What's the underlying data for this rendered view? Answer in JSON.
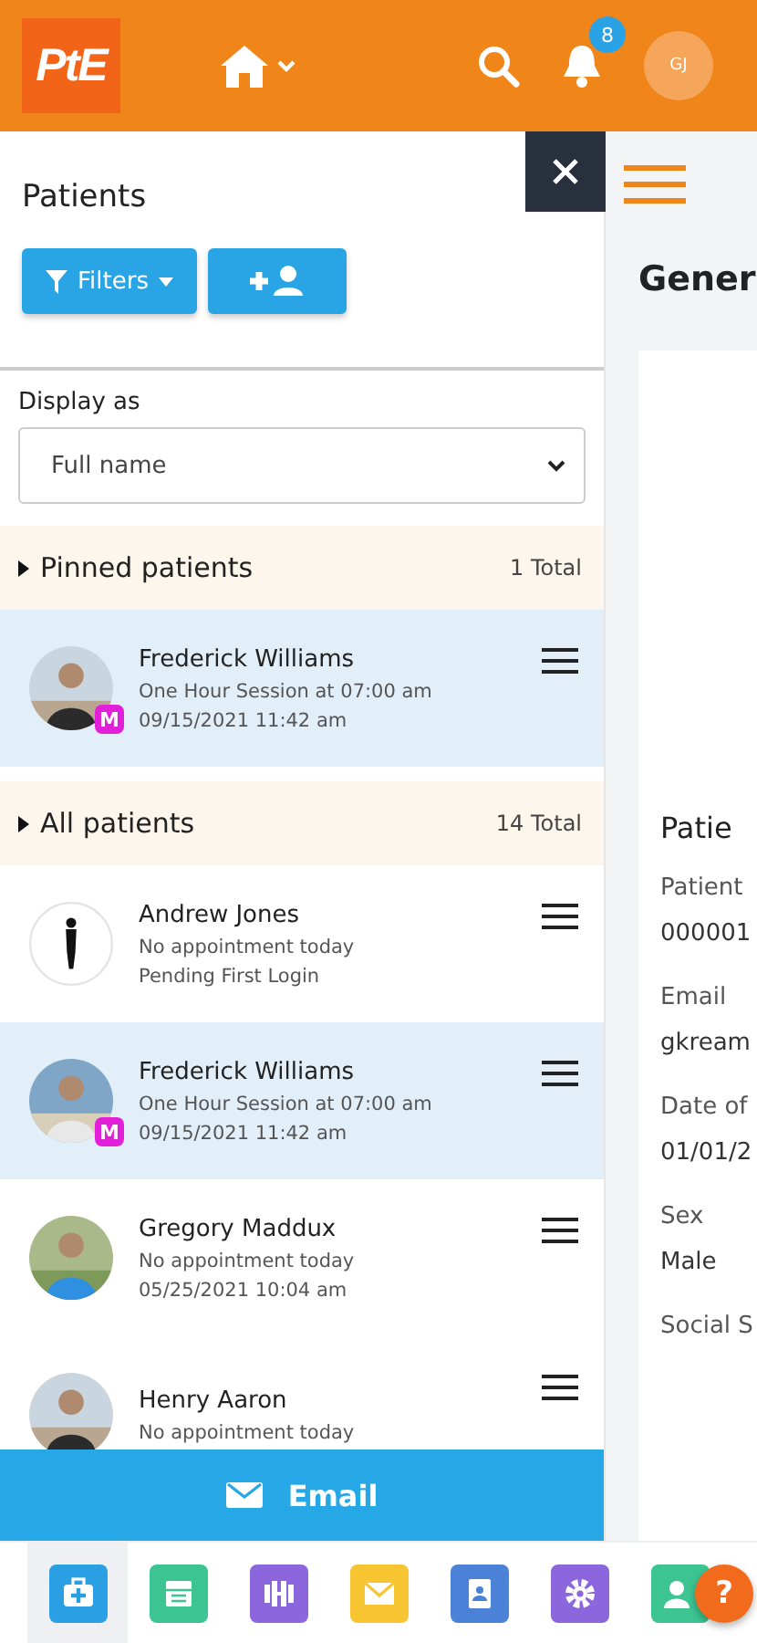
{
  "header": {
    "logo": "PtE",
    "notifications": "8",
    "avatar": "GJ"
  },
  "panel": {
    "title": "Patients",
    "filters_button": "Filters",
    "display_label": "Display as",
    "display_value": "Full name"
  },
  "sections": [
    {
      "title": "Pinned patients",
      "total": "1 Total",
      "expanded": true,
      "patients": [
        {
          "name": "Frederick Williams",
          "line1": "One Hour Session at 07:00 am",
          "line2": "09/15/2021 11:42 am",
          "kind": "picture",
          "badge": "M",
          "selected": true
        }
      ]
    },
    {
      "title": "All patients",
      "total": "14 Total",
      "expanded": true,
      "patients": [
        {
          "name": "Andrew Jones",
          "line1": "No appointment today",
          "line2": "Pending First Login",
          "kind": "silhouette",
          "selected": false
        },
        {
          "name": "Frederick Williams",
          "line1": "One Hour Session at 07:00 am",
          "line2": "09/15/2021 11:42 am",
          "kind": "picture",
          "badge": "M",
          "selected": true
        },
        {
          "name": "Gregory Maddux",
          "line1": "No appointment today",
          "line2": "05/25/2021 10:04 am",
          "kind": "picture",
          "selected": false
        },
        {
          "name": "Henry Aaron",
          "line1": "No appointment today",
          "kind": "picture",
          "selected": false
        }
      ]
    }
  ],
  "email_button": "Email",
  "detail": {
    "title": "Gener",
    "section": "Patie",
    "fields": [
      {
        "label": "Patient",
        "value": "000001"
      },
      {
        "label": "Email",
        "value": "gkream"
      },
      {
        "label": "Date of",
        "value": "01/01/2"
      },
      {
        "label": "Sex",
        "value": "Male"
      },
      {
        "label": "Social S"
      }
    ]
  },
  "nav": [
    {
      "kind": "medical",
      "color": "#2b9fe3",
      "selected": true
    },
    {
      "kind": "calendar",
      "color": "#3cc592",
      "selected": false
    },
    {
      "kind": "dumbbell",
      "color": "#8b66dc",
      "selected": false
    },
    {
      "kind": "mail",
      "color": "#f7c531",
      "selected": false
    },
    {
      "kind": "contacts",
      "color": "#4b82d8",
      "selected": false
    },
    {
      "kind": "gear",
      "color": "#8b66dc",
      "selected": false
    },
    {
      "kind": "person",
      "color": "#3cc592",
      "selected": false
    }
  ],
  "help": "?"
}
